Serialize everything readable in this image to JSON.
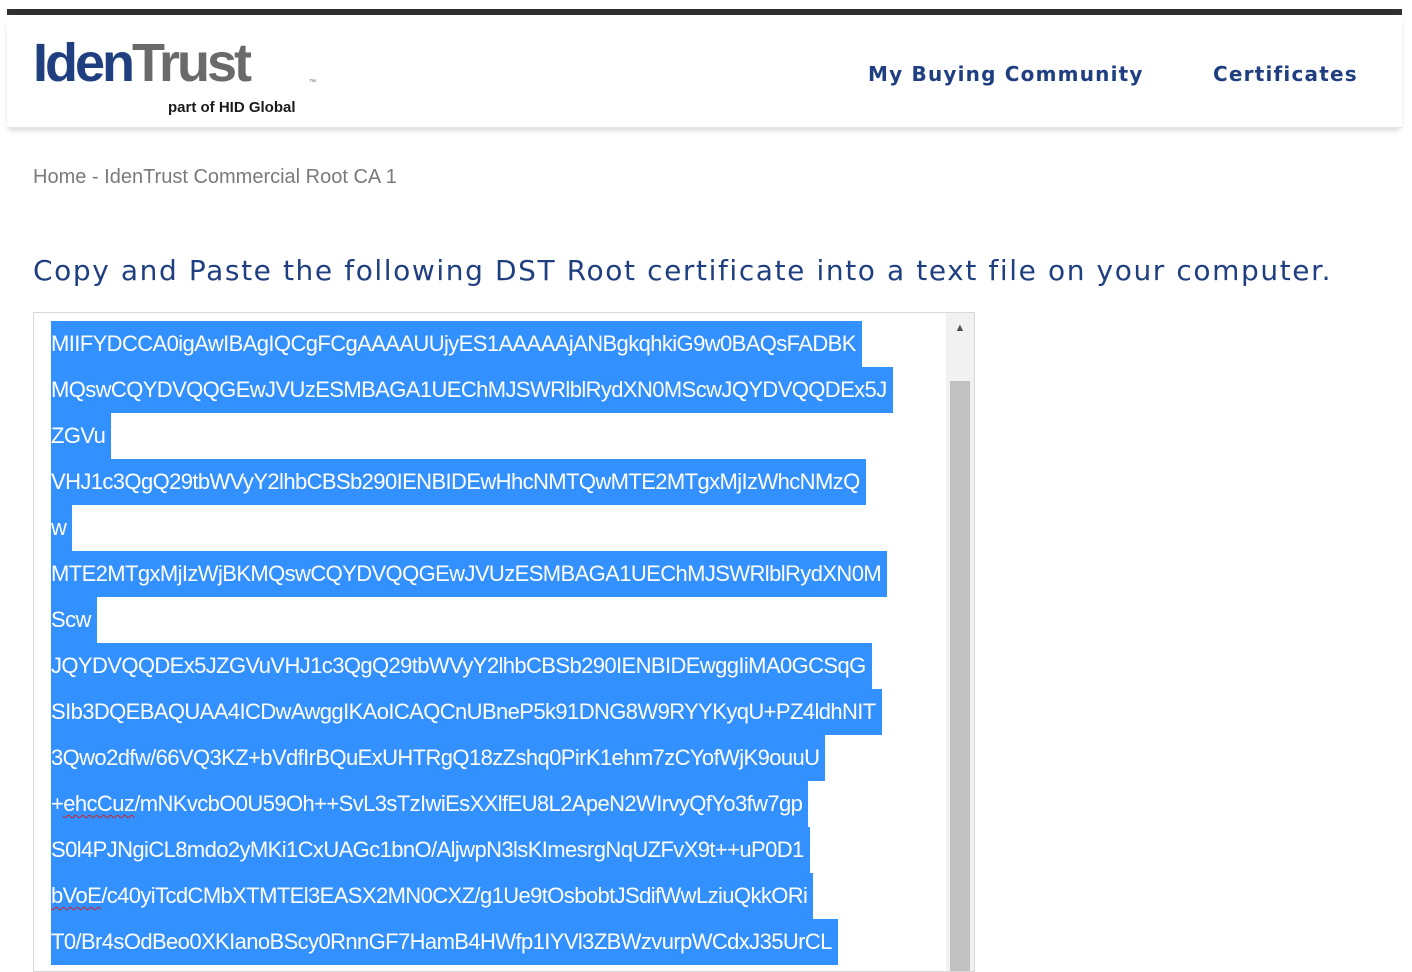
{
  "brand": {
    "name_part1": "Iden",
    "name_part2": "Trust",
    "trademark": "™",
    "tagline": "part of HID Global"
  },
  "nav": {
    "items": [
      {
        "label": "My Buying Community"
      },
      {
        "label": "Certificates"
      }
    ]
  },
  "breadcrumb": {
    "home": "Home",
    "separator": " - ",
    "current": "IdenTrust Commercial Root CA 1"
  },
  "instruction": "Copy and Paste the following DST Root certificate into a text file on your computer.",
  "certificate": {
    "lines": [
      "MIIFYDCCA0igAwIBAgIQCgFCgAAAAUUjyES1AAAAAjANBgkqhkiG9w0BAQsFADBK",
      "MQswCQYDVQQGEwJVUzESMBAGA1UEChMJSWRlblRydXN0MScwJQYDVQQDEx5J",
      "ZGVu",
      "VHJ1c3QgQ29tbWVyY2lhbCBSb290IENBIDEwHhcNMTQwMTE2MTgxMjIzWhcNMzQ",
      "w",
      "MTE2MTgxMjIzWjBKMQswCQYDVQQGEwJVUzESMBAGA1UEChMJSWRlblRydXN0M",
      "Scw",
      "JQYDVQQDEx5JZGVuVHJ1c3QgQ29tbWVyY2lhbCBSb290IENBIDEwggIiMA0GCSqG",
      "SIb3DQEBAQUAA4ICDwAwggIKAoICAQCnUBneP5k91DNG8W9RYYKyqU+PZ4ldhNIT",
      "3Qwo2dfw/66VQ3KZ+bVdfIrBQuExUHTRgQ18zZshq0PirK1ehm7zCYofWjK9ouuU",
      "+ehcCuz/mNKvcbO0U59Oh++SvL3sTzIwiEsXXlfEU8L2ApeN2WIrvyQfYo3fw7gp",
      "S0l4PJNgiCL8mdo2yMKi1CxUAGc1bnO/AljwpN3lsKImesrgNqUZFvX9t++uP0D1",
      "bVoE/c40yiTcdCMbXTMTEl3EASX2MN0CXZ/g1Ue9tOsbobtJSdifWwLziuQkkORi",
      "T0/Br4sOdBeo0XKIanoBScy0RnnGF7HamB4HWfp1IYVl3ZBWzvurpWCdxJ35UrCL"
    ],
    "squiggly_prefixes": [
      {
        "line": 10,
        "prefix": "+",
        "word": "ehcCuz",
        "rest": "/mNKvcbO0U59Oh++SvL3sTzIwiEsXXlfEU8L2ApeN2WIrvyQfYo3fw7gp"
      },
      {
        "line": 12,
        "prefix": "",
        "word": "bVoE",
        "rest": "/c40yiTcdCMbXTMTEl3EASX2MN0CXZ/g1Ue9tOsbobtJSdifWwLziuQkkORi"
      }
    ]
  },
  "scrollbar": {
    "up_arrow": "▲"
  },
  "colors": {
    "brand_blue": "#1f3f80",
    "brand_gray": "#6a6a6a",
    "selection": "#3390ff",
    "topbar": "#2f2f2f"
  }
}
